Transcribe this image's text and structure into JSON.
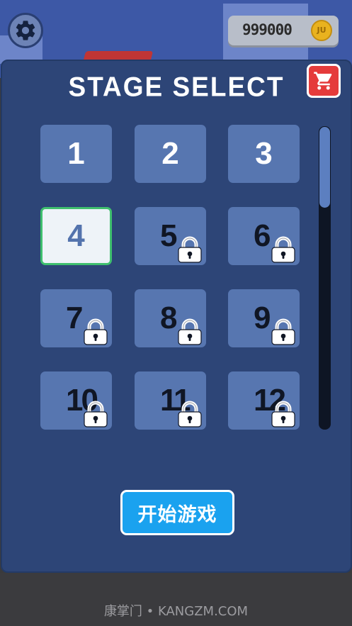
{
  "coins": {
    "value": "999000",
    "icon_label": "JU",
    "icon": "coin-icon"
  },
  "settings": {
    "icon": "gear-icon"
  },
  "panel": {
    "title": "STAGE SELECT",
    "shop_icon": "cart-icon"
  },
  "stages": [
    {
      "number": "1",
      "state": "unlocked"
    },
    {
      "number": "2",
      "state": "unlocked"
    },
    {
      "number": "3",
      "state": "unlocked"
    },
    {
      "number": "4",
      "state": "selected"
    },
    {
      "number": "5",
      "state": "locked"
    },
    {
      "number": "6",
      "state": "locked"
    },
    {
      "number": "7",
      "state": "locked"
    },
    {
      "number": "8",
      "state": "locked"
    },
    {
      "number": "9",
      "state": "locked"
    },
    {
      "number": "10",
      "state": "locked"
    },
    {
      "number": "11",
      "state": "locked"
    },
    {
      "number": "12",
      "state": "locked"
    }
  ],
  "start_button": {
    "label": "开始游戏"
  },
  "watermark": "康掌门 • KANGZM.COM",
  "colors": {
    "panel": "#2d4577",
    "tile": "#5776b0",
    "selected_border": "#3fbf6e",
    "start": "#1aa2ef",
    "shop": "#e53b3b"
  }
}
